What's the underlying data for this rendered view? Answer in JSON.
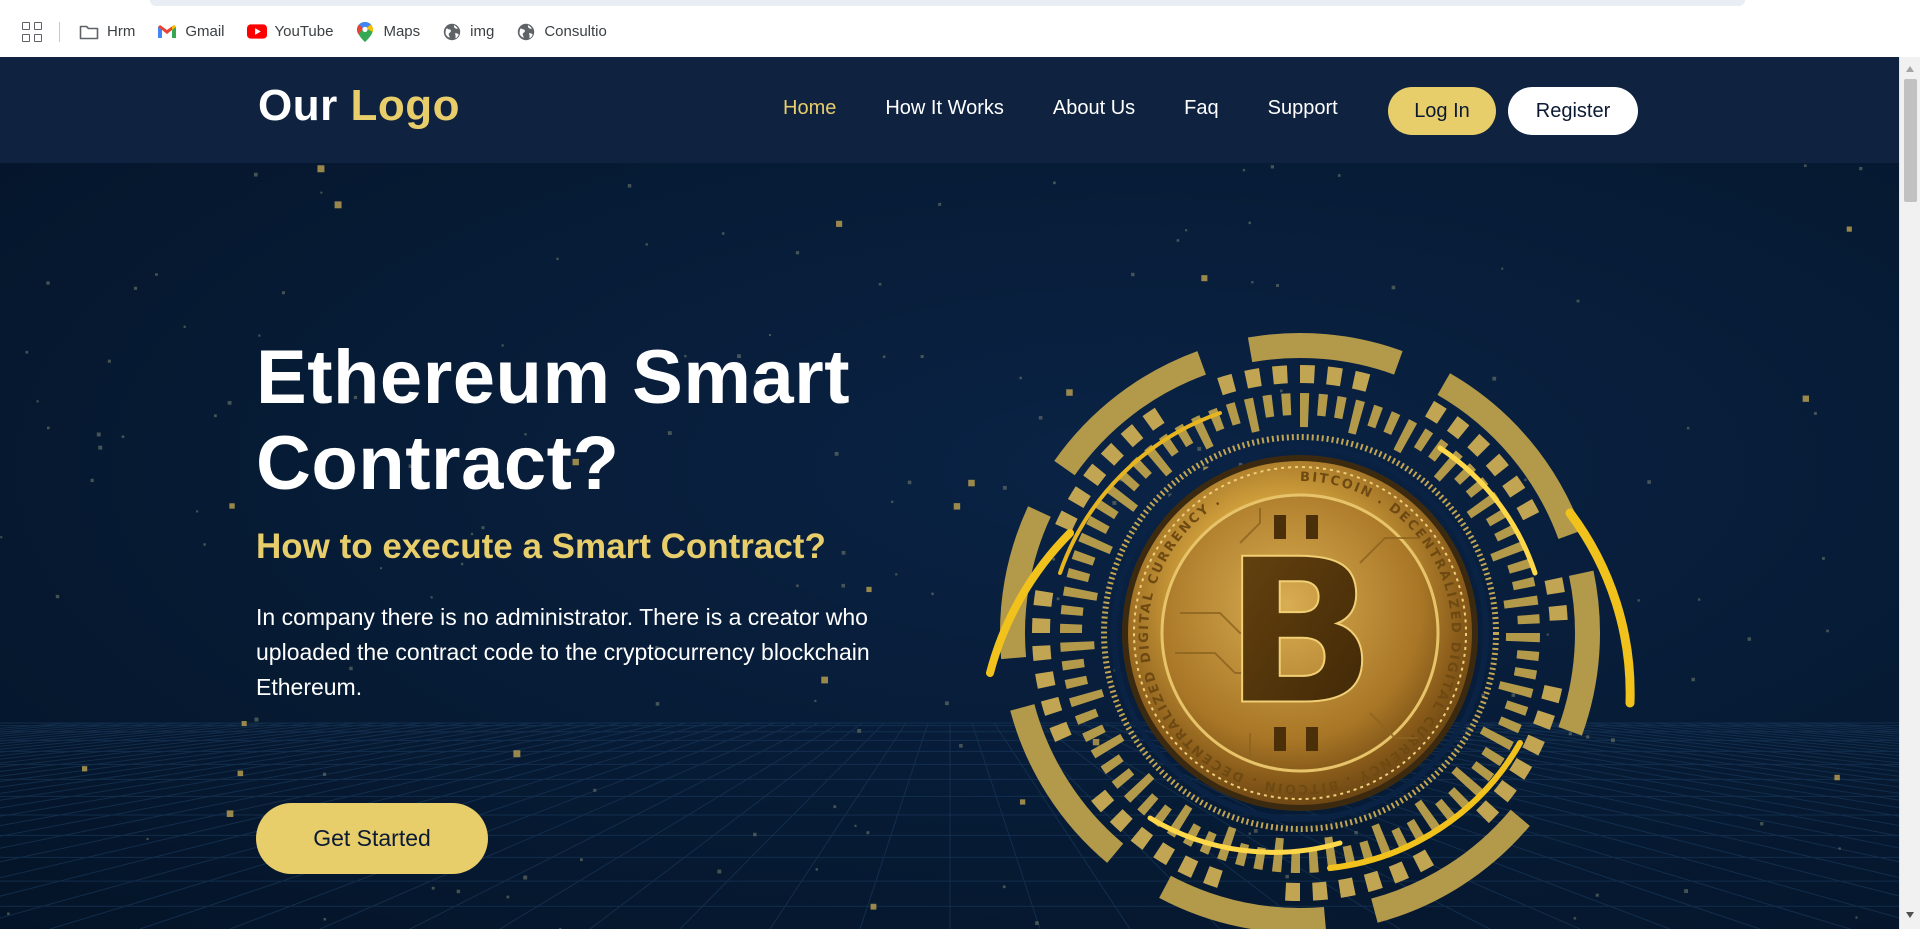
{
  "browser": {
    "bookmarks": [
      {
        "label": "Hrm",
        "icon": "folder-icon"
      },
      {
        "label": "Gmail",
        "icon": "gmail-icon"
      },
      {
        "label": "YouTube",
        "icon": "youtube-icon"
      },
      {
        "label": "Maps",
        "icon": "maps-pin-icon"
      },
      {
        "label": "img",
        "icon": "globe-icon"
      },
      {
        "label": "Consultio",
        "icon": "globe-icon"
      }
    ]
  },
  "header": {
    "logo_primary": "Our",
    "logo_accent": "Logo",
    "nav": [
      {
        "label": "Home",
        "active": true
      },
      {
        "label": "How It Works",
        "active": false
      },
      {
        "label": "About Us",
        "active": false
      },
      {
        "label": "Faq",
        "active": false
      },
      {
        "label": "Support",
        "active": false
      }
    ],
    "login_label": "Log In",
    "register_label": "Register"
  },
  "hero": {
    "title": "Ethereum Smart Contract?",
    "subtitle": "How to execute a Smart Contract?",
    "description": "In company there is no administrator. There is a creator who uploaded the contract code to the cryptocurrency blockchain Ethereum.",
    "cta_label": "Get Started",
    "coin_ring_text": "BITCOIN . DECENTRALIZED DIGITAL CURRENCY . BITCOIN . DECENTRALIZED DIGITAL CURRENCY . ",
    "coin_symbol": "B"
  },
  "colors": {
    "accent": "#e8cd6b",
    "background": "#061a33",
    "header_bg": "#0f2240",
    "text": "#ffffff"
  }
}
